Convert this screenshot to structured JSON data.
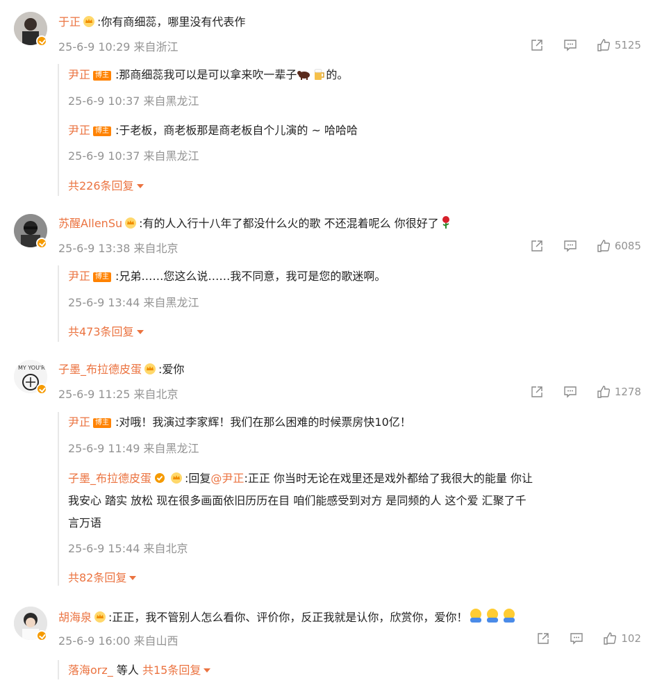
{
  "comments": [
    {
      "name": "于正",
      "text": ":你有商细蕊，哪里没有代表作",
      "meta": "25-6-9 10:29 来自浙江",
      "likes": "5125",
      "replies": [
        {
          "name": "尹正",
          "badge": "博主",
          "text": ":那商细蕊我可以是可以拿来吹一辈子",
          "text2": "的。",
          "meta": "25-6-9 10:37 来自黑龙江"
        },
        {
          "name": "尹正",
          "badge": "博主",
          "text": ":于老板，商老板那是商老板自个儿演的 ~ 哈哈哈",
          "meta": "25-6-9 10:37 来自黑龙江"
        }
      ],
      "more": "共226条回复"
    },
    {
      "name": "苏醒AllenSu",
      "text": ":有的人入行十八年了都没什么火的歌 不还混着呢么 你很好了",
      "meta": "25-6-9 13:38 来自北京",
      "likes": "6085",
      "replies": [
        {
          "name": "尹正",
          "badge": "博主",
          "text": ":兄弟……您这么说……我不同意，我可是您的歌迷啊。",
          "meta": "25-6-9 13:44 来自黑龙江"
        }
      ],
      "more": "共473条回复"
    },
    {
      "name": "子墨_布拉德皮蛋",
      "text": ":爱你",
      "meta": "25-6-9 11:25 来自北京",
      "likes": "1278",
      "replies": [
        {
          "name": "尹正",
          "badge": "博主",
          "text": ":对哦！我演过李家辉！我们在那么困难的时候票房快10亿！",
          "meta": "25-6-9 11:49 来自黑龙江"
        },
        {
          "name": "子墨_布拉德皮蛋",
          "mention": "@尹正",
          "text_pre": ":回复",
          "text": ":正正 你当时无论在戏里还是戏外都给了我很大的能量 你让",
          "text_l2": "我安心 踏实 放松 现在很多画面依旧历历在目 咱们能感受到对方 是同频的人 这个爱 汇聚了千",
          "text_l3": "言万语",
          "meta": "25-6-9 15:44 来自北京"
        }
      ],
      "more": "共82条回复"
    },
    {
      "name": "胡海泉",
      "text": ":正正，我不管别人怎么看你、评价你，反正我就是认你，欣赏你，爱你！",
      "meta": "25-6-9 16:00 来自山西",
      "likes": "102",
      "footer": {
        "user": "落海orz_",
        "etc": "等人",
        "count": "共15条回复"
      }
    }
  ]
}
